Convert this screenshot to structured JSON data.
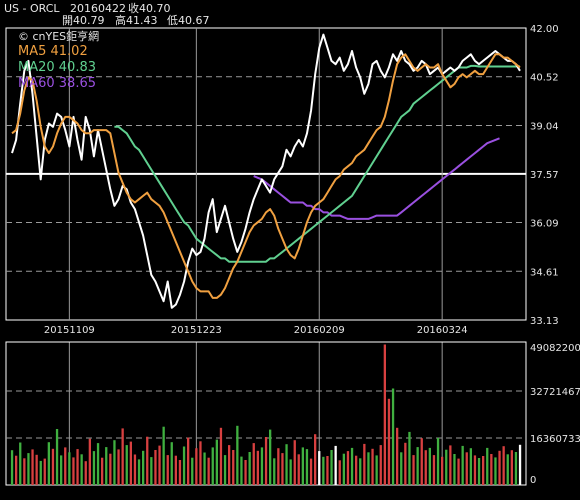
{
  "header": {
    "symbol": "US - ORCL",
    "date": "20160422",
    "close_label": "收40.70",
    "open_label": "開40.79",
    "high_label": "高41.43",
    "low_label": "低40.67"
  },
  "watermark": "© cnYES鉅亨網",
  "legend": {
    "ma5": "MA5 41.02",
    "ma20": "MA20 40.83",
    "ma60": "MA60 38.65"
  },
  "colors": {
    "background": "#000000",
    "price": "#ffffff",
    "ma5": "#f0a040",
    "ma20": "#60d090",
    "ma60": "#9a50e0",
    "vol_up": "#d84040",
    "vol_down": "#40b040",
    "vol_flat": "#ffffff",
    "grid_dash": "#9a9a9a",
    "highlight_line": "#ffffff"
  },
  "chart_data": [
    {
      "type": "line",
      "y_ticks": [
        42.0,
        40.52,
        39.04,
        37.57,
        36.09,
        34.61,
        33.13
      ],
      "y_tick_labels": [
        "42.00",
        "40.52",
        "39.04",
        "37.57",
        "36.09",
        "34.61",
        "33.13"
      ],
      "ylim": [
        33.13,
        42.0
      ],
      "x_tick_labels": [
        "20151109",
        "20151223",
        "20160209",
        "20160324"
      ],
      "x_tick_index": [
        14,
        45,
        75,
        105
      ],
      "n": 125,
      "highlight_level": 37.57,
      "series": [
        {
          "name": "MA5",
          "values": [
            38.8,
            38.9,
            39.4,
            40.1,
            40.5,
            40.4,
            39.8,
            39.0,
            38.4,
            38.2,
            38.4,
            38.8,
            39.1,
            39.3,
            39.3,
            39.2,
            39.1,
            38.9,
            38.8,
            38.8,
            38.9,
            38.9,
            38.9,
            38.9,
            38.8,
            38.2,
            37.6,
            37.3,
            37.0,
            36.8,
            36.7,
            36.8,
            36.9,
            37.0,
            36.8,
            36.7,
            36.6,
            36.4,
            36.1,
            35.8,
            35.5,
            35.2,
            34.9,
            34.6,
            34.3,
            34.1,
            34.0,
            34.0,
            34.0,
            33.8,
            33.8,
            33.9,
            34.1,
            34.4,
            34.7,
            34.9,
            35.2,
            35.5,
            35.8,
            36.0,
            36.1,
            36.2,
            36.4,
            36.5,
            36.3,
            35.9,
            35.6,
            35.3,
            35.1,
            35.0,
            35.3,
            35.7,
            36.1,
            36.4,
            36.6,
            36.7,
            36.8,
            37.0,
            37.2,
            37.4,
            37.5,
            37.7,
            37.8,
            37.9,
            38.1,
            38.2,
            38.3,
            38.5,
            38.7,
            38.9,
            39.0,
            39.3,
            39.8,
            40.4,
            40.9,
            41.1,
            41.2,
            41.0,
            40.8,
            40.7,
            40.8,
            40.9,
            40.8,
            40.8,
            40.9,
            40.6,
            40.4,
            40.2,
            40.3,
            40.5,
            40.6,
            40.5,
            40.6,
            40.7,
            40.6,
            40.6,
            40.8,
            41.0,
            41.2,
            41.2,
            41.1,
            41.1,
            41.0,
            40.9,
            40.8
          ]
        },
        {
          "name": "MA20",
          "values": [
            null,
            null,
            null,
            null,
            null,
            null,
            null,
            null,
            null,
            null,
            null,
            null,
            null,
            null,
            null,
            null,
            null,
            null,
            null,
            null,
            null,
            null,
            null,
            null,
            null,
            39.0,
            39.0,
            38.9,
            38.8,
            38.6,
            38.4,
            38.3,
            38.1,
            37.9,
            37.7,
            37.5,
            37.3,
            37.1,
            36.9,
            36.7,
            36.5,
            36.3,
            36.1,
            36.0,
            35.8,
            35.6,
            35.5,
            35.4,
            35.3,
            35.2,
            35.1,
            35.0,
            35.0,
            34.9,
            34.9,
            34.9,
            34.9,
            34.9,
            34.9,
            34.9,
            34.9,
            34.9,
            34.9,
            35.0,
            35.0,
            35.1,
            35.2,
            35.3,
            35.4,
            35.5,
            35.6,
            35.7,
            35.8,
            35.9,
            36.0,
            36.1,
            36.2,
            36.3,
            36.4,
            36.5,
            36.6,
            36.7,
            36.8,
            36.9,
            37.1,
            37.3,
            37.5,
            37.7,
            37.9,
            38.1,
            38.3,
            38.5,
            38.7,
            38.9,
            39.1,
            39.3,
            39.4,
            39.5,
            39.7,
            39.8,
            39.9,
            40.0,
            40.1,
            40.2,
            40.3,
            40.4,
            40.5,
            40.6,
            40.7,
            40.8,
            40.8,
            40.8,
            40.85,
            40.85,
            40.83,
            40.83,
            40.83,
            40.83,
            40.83,
            40.83,
            40.83,
            40.83,
            40.83,
            40.83,
            40.83
          ]
        },
        {
          "name": "MA60",
          "values": [
            null,
            null,
            null,
            null,
            null,
            null,
            null,
            null,
            null,
            null,
            null,
            null,
            null,
            null,
            null,
            null,
            null,
            null,
            null,
            null,
            null,
            null,
            null,
            null,
            null,
            null,
            null,
            null,
            null,
            null,
            null,
            null,
            null,
            null,
            null,
            null,
            null,
            null,
            null,
            null,
            null,
            null,
            null,
            null,
            null,
            null,
            null,
            null,
            null,
            null,
            null,
            null,
            null,
            null,
            null,
            null,
            null,
            null,
            null,
            37.5,
            37.45,
            37.4,
            37.3,
            37.2,
            37.1,
            37.0,
            36.9,
            36.8,
            36.7,
            36.7,
            36.7,
            36.7,
            36.6,
            36.6,
            36.5,
            36.5,
            36.4,
            36.4,
            36.3,
            36.3,
            36.3,
            36.25,
            36.2,
            36.2,
            36.2,
            36.2,
            36.2,
            36.2,
            36.25,
            36.3,
            36.3,
            36.3,
            36.3,
            36.3,
            36.3,
            36.4,
            36.5,
            36.6,
            36.7,
            36.8,
            36.9,
            37.0,
            37.1,
            37.2,
            37.3,
            37.4,
            37.5,
            37.6,
            37.7,
            37.8,
            37.9,
            38.0,
            38.1,
            38.2,
            38.3,
            38.4,
            38.5,
            38.55,
            38.6,
            38.65
          ]
        },
        {
          "name": "Price",
          "values": [
            38.2,
            38.6,
            39.7,
            40.7,
            41.0,
            40.0,
            38.7,
            37.4,
            38.6,
            39.1,
            39.0,
            39.4,
            39.3,
            38.9,
            38.4,
            39.3,
            38.6,
            38.0,
            39.3,
            38.9,
            38.1,
            38.9,
            38.3,
            37.7,
            37.1,
            36.6,
            36.8,
            37.2,
            37.1,
            36.7,
            36.5,
            36.1,
            35.7,
            35.1,
            34.5,
            34.3,
            34.0,
            33.7,
            34.3,
            33.5,
            33.6,
            33.9,
            34.3,
            34.9,
            35.3,
            35.1,
            35.2,
            35.6,
            36.4,
            36.8,
            35.8,
            36.2,
            36.6,
            36.1,
            35.6,
            35.2,
            35.5,
            35.9,
            36.4,
            36.8,
            37.1,
            37.4,
            37.2,
            37.0,
            37.4,
            37.6,
            37.8,
            38.3,
            38.1,
            38.4,
            38.6,
            38.4,
            38.8,
            39.5,
            40.6,
            41.4,
            41.8,
            41.4,
            41.0,
            40.9,
            41.1,
            40.7,
            40.9,
            41.3,
            40.8,
            40.5,
            40.0,
            40.3,
            40.9,
            41.0,
            40.7,
            40.5,
            40.8,
            41.2,
            41.0,
            41.3,
            41.0,
            40.9,
            40.7,
            40.8,
            41.0,
            40.9,
            40.6,
            40.7,
            40.8,
            40.6,
            40.7,
            40.8,
            40.7,
            40.8,
            41.0,
            41.1,
            41.2,
            41.0,
            40.9,
            41.0,
            41.1,
            41.2,
            41.3,
            41.2,
            41.1,
            41.0,
            41.0,
            40.9,
            40.7
          ]
        }
      ]
    },
    {
      "type": "bar",
      "y_ticks": [
        0,
        16360733,
        32721467,
        49082200
      ],
      "y_tick_labels": [
        "0",
        "16360733",
        "32721467",
        "49082200"
      ],
      "ylim": [
        0,
        49082200
      ],
      "values": [
        12.1,
        10.2,
        14.8,
        9.3,
        11.1,
        12.4,
        10.5,
        8.4,
        9.2,
        14.9,
        12.6,
        19.5,
        10.3,
        13.1,
        11.4,
        9.6,
        12.5,
        10.7,
        8.3,
        16.1,
        11.8,
        14.6,
        9.5,
        13.2,
        10.9,
        15.6,
        12.4,
        19.7,
        13.9,
        15.1,
        10.6,
        8.9,
        11.9,
        16.8,
        9.7,
        12.2,
        13.7,
        20.3,
        10.4,
        14.9,
        10.2,
        8.7,
        13.4,
        16.5,
        9.5,
        12.8,
        15.2,
        11.3,
        9.5,
        13.1,
        15.8,
        19.9,
        10.4,
        13.9,
        12.2,
        20.6,
        9.9,
        8.7,
        11.5,
        14.6,
        11.9,
        13.1,
        16.7,
        19.3,
        9.3,
        12.8,
        11.1,
        14.2,
        8.9,
        15.6,
        10.7,
        13.1,
        12.5,
        9.2,
        17.7,
        11.8,
        9.8,
        10.1,
        12.2,
        13.6,
        8.6,
        10.9,
        11.8,
        12.9,
        10.2,
        9.3,
        14.3,
        11.4,
        12.6,
        10.3,
        13.9,
        48.9,
        30.0,
        33.6,
        19.9,
        11.4,
        14.7,
        18.5,
        10.4,
        13.2,
        16.3,
        12.1,
        12.9,
        10.4,
        16.4,
        9.8,
        12.3,
        13.8,
        10.8,
        9.2,
        13.6,
        11.4,
        12.8,
        10.3,
        9.4,
        10.1,
        12.9,
        10.8,
        9.6,
        11.9,
        13.5,
        10.7,
        12.1,
        11.5,
        14.0
      ],
      "units_note": "million shares",
      "directions": [
        "d",
        "u",
        "d",
        "u",
        "d",
        "u",
        "u",
        "d",
        "u",
        "d",
        "u",
        "d",
        "d",
        "u",
        "d",
        "u",
        "u",
        "d",
        "u",
        "u",
        "d",
        "d",
        "u",
        "d",
        "u",
        "d",
        "u",
        "u",
        "d",
        "u",
        "u",
        "d",
        "d",
        "u",
        "d",
        "u",
        "u",
        "d",
        "u",
        "d",
        "u",
        "u",
        "d",
        "u",
        "d",
        "u",
        "u",
        "d",
        "u",
        "d",
        "d",
        "u",
        "d",
        "u",
        "u",
        "d",
        "d",
        "u",
        "d",
        "u",
        "u",
        "d",
        "u",
        "d",
        "d",
        "u",
        "u",
        "d",
        "d",
        "u",
        "u",
        "d",
        "d",
        "u",
        "u",
        "f",
        "d",
        "u",
        "d",
        "f",
        "u",
        "d",
        "u",
        "d",
        "u",
        "d",
        "u",
        "d",
        "u",
        "d",
        "u",
        "u",
        "u",
        "d",
        "u",
        "d",
        "u",
        "d",
        "u",
        "d",
        "u",
        "u",
        "d",
        "u",
        "d",
        "u",
        "d",
        "u",
        "d",
        "u",
        "d",
        "u",
        "d",
        "u",
        "d",
        "u",
        "d",
        "u",
        "d",
        "u",
        "u",
        "d",
        "u",
        "d"
      ]
    }
  ]
}
